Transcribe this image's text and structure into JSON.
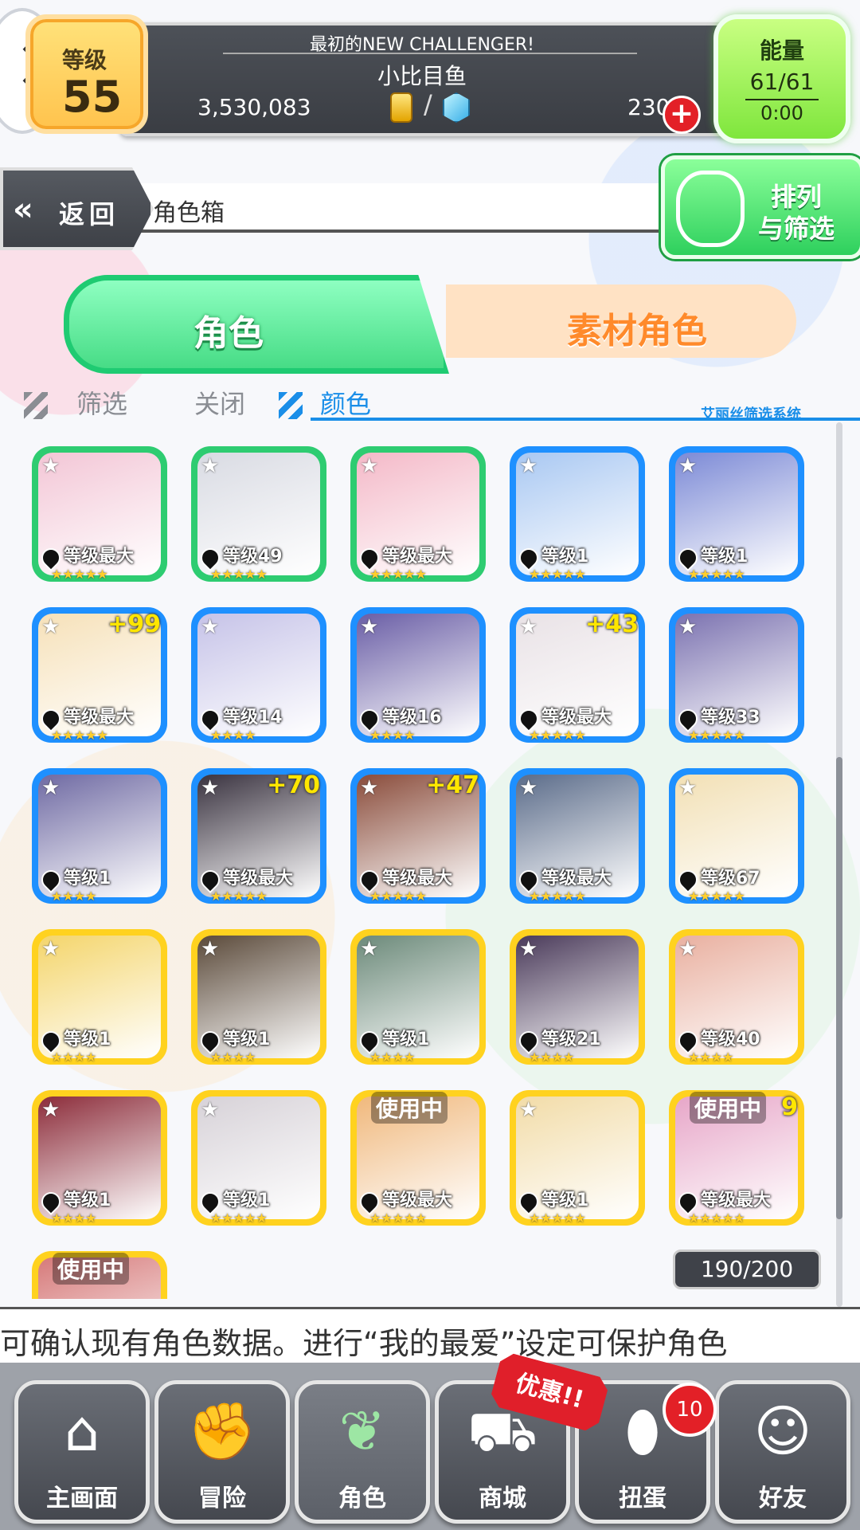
{
  "header": {
    "level_label": "等级",
    "level_value": "55",
    "subtitle": "最初的NEW CHALLENGER!",
    "player_name": "小比目鱼",
    "coins": "3,530,083",
    "currency_slash": "/",
    "gems": "230",
    "energy_label": "能量",
    "energy_value": "61/61",
    "energy_timer": "0:00"
  },
  "nav_row": {
    "back_label": "返回",
    "back_icon": "«",
    "title": "角色箱",
    "sort_label_1": "排列",
    "sort_label_2": "与筛选"
  },
  "tabs": {
    "active": "角色",
    "inactive": "素材角色"
  },
  "filter": {
    "label": "筛选",
    "state": "关闭",
    "mode": "颜色",
    "system": "艾丽丝筛选系统"
  },
  "characters": [
    {
      "frame": "#2ecc71",
      "level": "等级最大",
      "plus": "",
      "stars": "★★★★★",
      "in_use": ""
    },
    {
      "frame": "#2ecc71",
      "level": "等级49",
      "plus": "",
      "stars": "★★★★★",
      "in_use": ""
    },
    {
      "frame": "#2ecc71",
      "level": "等级最大",
      "plus": "",
      "stars": "★★★★★",
      "in_use": ""
    },
    {
      "frame": "#1e90ff",
      "level": "等级1",
      "plus": "",
      "stars": "★★★★★",
      "in_use": ""
    },
    {
      "frame": "#1e90ff",
      "level": "等级1",
      "plus": "",
      "stars": "★★★★★",
      "in_use": ""
    },
    {
      "frame": "#1e90ff",
      "level": "等级最大",
      "plus": "+99",
      "stars": "★★★★★",
      "in_use": ""
    },
    {
      "frame": "#1e90ff",
      "level": "等级14",
      "plus": "",
      "stars": "★★★★",
      "in_use": ""
    },
    {
      "frame": "#1e90ff",
      "level": "等级16",
      "plus": "",
      "stars": "★★★★",
      "in_use": ""
    },
    {
      "frame": "#1e90ff",
      "level": "等级最大",
      "plus": "+43",
      "stars": "★★★★★",
      "in_use": ""
    },
    {
      "frame": "#1e90ff",
      "level": "等级33",
      "plus": "",
      "stars": "★★★★★",
      "in_use": ""
    },
    {
      "frame": "#1e90ff",
      "level": "等级1",
      "plus": "",
      "stars": "★★★★",
      "in_use": ""
    },
    {
      "frame": "#1e90ff",
      "level": "等级最大",
      "plus": "+70",
      "stars": "★★★★★",
      "in_use": ""
    },
    {
      "frame": "#1e90ff",
      "level": "等级最大",
      "plus": "+47",
      "stars": "★★★★★",
      "in_use": ""
    },
    {
      "frame": "#1e90ff",
      "level": "等级最大",
      "plus": "",
      "stars": "★★★★★",
      "in_use": ""
    },
    {
      "frame": "#1e90ff",
      "level": "等级67",
      "plus": "",
      "stars": "★★★★★",
      "in_use": ""
    },
    {
      "frame": "#ffd21f",
      "level": "等级1",
      "plus": "",
      "stars": "★★★★",
      "in_use": ""
    },
    {
      "frame": "#ffd21f",
      "level": "等级1",
      "plus": "",
      "stars": "★★★★",
      "in_use": ""
    },
    {
      "frame": "#ffd21f",
      "level": "等级1",
      "plus": "",
      "stars": "★★★★",
      "in_use": ""
    },
    {
      "frame": "#ffd21f",
      "level": "等级21",
      "plus": "",
      "stars": "★★★★",
      "in_use": ""
    },
    {
      "frame": "#ffd21f",
      "level": "等级40",
      "plus": "",
      "stars": "★★★★",
      "in_use": ""
    },
    {
      "frame": "#ffd21f",
      "level": "等级1",
      "plus": "",
      "stars": "★★★★",
      "in_use": ""
    },
    {
      "frame": "#ffd21f",
      "level": "等级1",
      "plus": "",
      "stars": "★★★★★",
      "in_use": ""
    },
    {
      "frame": "#ffd21f",
      "level": "等级最大",
      "plus": "",
      "stars": "★★★★★",
      "in_use": "使用中"
    },
    {
      "frame": "#ffd21f",
      "level": "等级1",
      "plus": "",
      "stars": "★★★★★",
      "in_use": ""
    },
    {
      "frame": "#ffd21f",
      "level": "等级最大",
      "plus": "9",
      "stars": "★★★★★",
      "in_use": "使用中"
    },
    {
      "frame": "#ffd21f",
      "level": "",
      "plus": "",
      "stars": "",
      "in_use": "使用中"
    }
  ],
  "box_count": "190/200",
  "ticker": "可确认现有角色数据。进行“我的最爱”设定可保护角色",
  "bottom_nav": {
    "home": "主画面",
    "adventure": "冒险",
    "characters": "角色",
    "shop": "商城",
    "gacha": "扭蛋",
    "friends": "好友",
    "promo": "优惠!!",
    "gacha_badge": "10"
  }
}
